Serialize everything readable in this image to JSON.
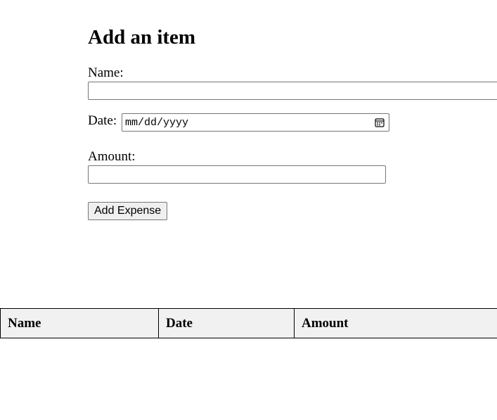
{
  "form": {
    "title": "Add an item",
    "name_label": "Name:",
    "name_value": "",
    "date_label": "Date:",
    "date_placeholder": "mm/dd/yyyy",
    "amount_label": "Amount:",
    "amount_value": "",
    "submit_label": "Add Expense",
    "date_icon": "calendar-icon"
  },
  "table": {
    "columns": [
      "Name",
      "Date",
      "Amount"
    ],
    "rows": []
  }
}
